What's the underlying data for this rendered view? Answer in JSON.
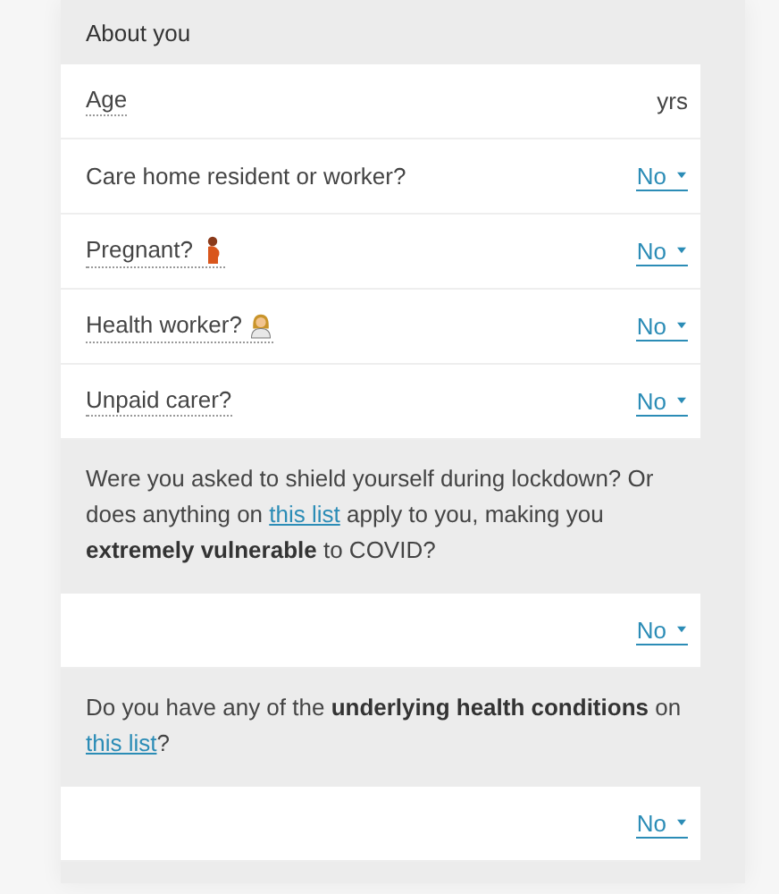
{
  "section": {
    "title": "About you"
  },
  "rows": [
    {
      "kind": "number",
      "label": "Age",
      "unit": "yrs"
    },
    {
      "kind": "select",
      "label": "Care home resident or worker?",
      "dotted": false,
      "value": "No"
    },
    {
      "kind": "select",
      "label": "Pregnant?",
      "dotted": true,
      "value": "No"
    },
    {
      "kind": "select",
      "label": "Health worker?",
      "dotted": true,
      "value": "No"
    },
    {
      "kind": "select",
      "label": "Unpaid carer?",
      "dotted": true,
      "value": "No"
    }
  ],
  "questions": [
    {
      "parts": [
        {
          "kind": "text",
          "text": "Were you asked to shield yourself during lockdown? Or does anything on "
        },
        {
          "kind": "link",
          "text": "this list"
        },
        {
          "kind": "text",
          "text": " apply to you, making you **extremely vulnerable** to COVID?"
        }
      ],
      "value": "No"
    },
    {
      "parts": [
        {
          "kind": "text",
          "text": "Do you have any of the **underlying health conditions** on "
        },
        {
          "kind": "link",
          "text": "this list"
        },
        {
          "kind": "text",
          "text": "?"
        }
      ],
      "value": "No"
    }
  ]
}
